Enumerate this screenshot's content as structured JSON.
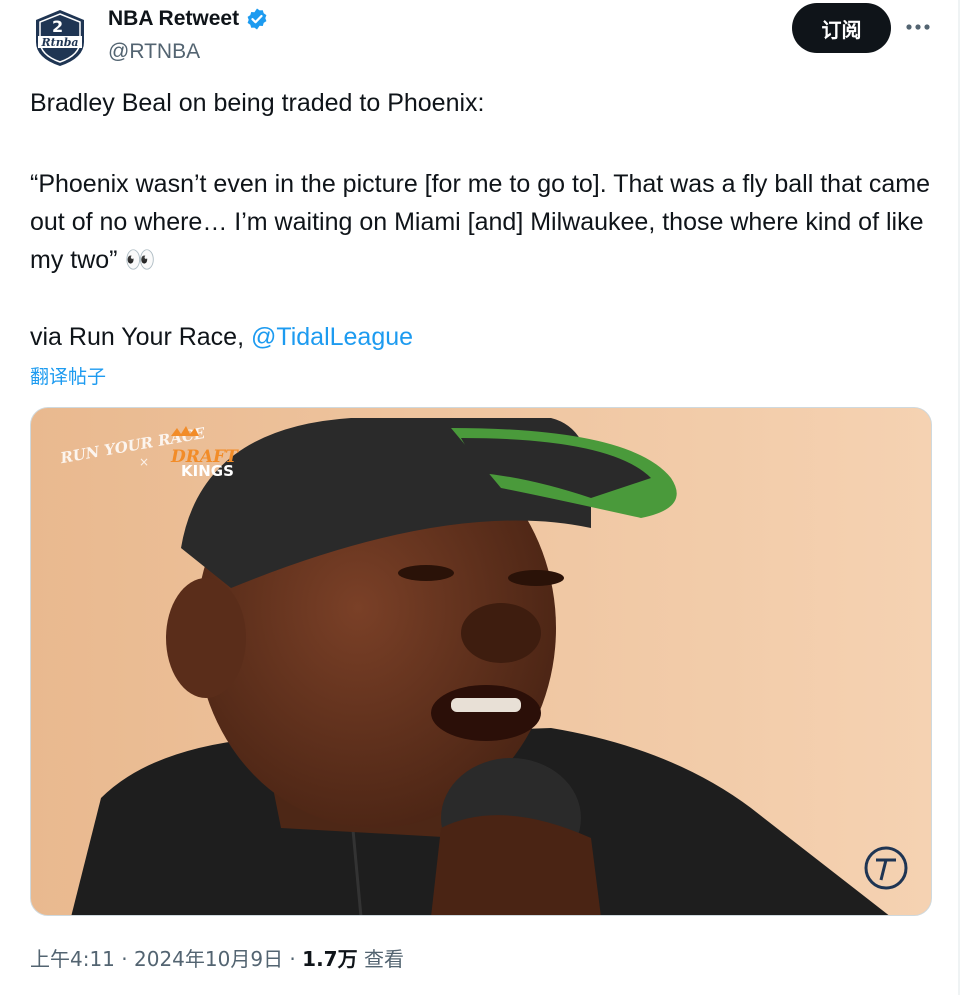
{
  "author": {
    "display_name": "NBA Retweet",
    "handle": "@RTNBA",
    "avatar_text": "Rtnba",
    "verified_icon": "verified-badge-icon"
  },
  "header": {
    "subscribe_label": "订阅",
    "more_icon": "more-dots-icon"
  },
  "tweet": {
    "line1": "Bradley Beal on being traded to Phoenix:",
    "quote": "“Phoenix wasn’t even in the picture [for me to go to]. That was a fly ball that came out of no where… I’m waiting on Miami [and] Milwaukee, those where kind of like my two” 👀",
    "via_prefix": "via Run Your Race, ",
    "mention": "@TidalLeague",
    "translate_label": "翻译帖子"
  },
  "media": {
    "logo_left": "RUN YOUR RACE",
    "logo_x": "×",
    "logo_brand_1": "DRAFT",
    "logo_brand_2": "KINGS",
    "colors": {
      "background": "#f2c9a5",
      "cap": "#2a2a2a",
      "brim": "#4a9a3b",
      "hoodie": "#1e1e1e"
    }
  },
  "meta": {
    "time": "上午4:11",
    "sep1": " · ",
    "date": "2024年10月9日",
    "sep2": " · ",
    "views_count": "1.7万",
    "views_label": " 查看"
  },
  "colors": {
    "accent": "#1d9bf0",
    "text": "#0f1419",
    "muted": "#536471"
  }
}
